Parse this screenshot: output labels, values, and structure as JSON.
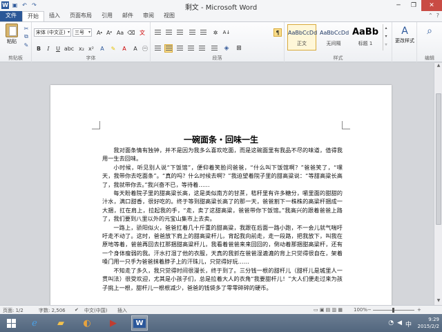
{
  "titlebar": {
    "title": "剩文 - Microsoft Word",
    "qat": [
      "word-icon",
      "save-icon",
      "undo-icon",
      "redo-icon"
    ]
  },
  "tabs": {
    "file": "文件",
    "items": [
      "开始",
      "插入",
      "页面布局",
      "引用",
      "邮件",
      "审阅",
      "视图"
    ],
    "active": "开始"
  },
  "ribbon": {
    "clipboard": {
      "paste": "粘贴",
      "label": "剪贴板"
    },
    "font": {
      "font_name": "宋体 (中文正)",
      "font_size": "三号",
      "label": "字体",
      "bold": "B",
      "italic": "I",
      "underline": "U"
    },
    "paragraph": {
      "label": "段落"
    },
    "styles": {
      "label": "样式",
      "items": [
        {
          "sample": "AaBbCcDd",
          "name": "正文"
        },
        {
          "sample": "AaBbCcDd",
          "name": "无间隔"
        },
        {
          "sample": "AaBb",
          "name": "标题 1"
        }
      ],
      "change_styles": "更改样式"
    },
    "editing": {
      "label": "编辑"
    }
  },
  "document": {
    "title": "一碗面条・回味一生",
    "paragraphs": [
      "我对面条情有独钟，并不是因为我多么喜欢吃面，而是这碗面里有我品不尽的味道，值得我用一生去回味。",
      "小时候，听见别人说“下饭馆”，便仰着笑脸问爸爸，“什么叫下饭馆啊？”爸爸笑了，“嘿天，我带你去吃面条”。“真的吗？什么时候去啊？”我迫望着院子里的甜高粱说：“等甜高粱长高了，我就带你去。”我兴奋不已，等待着……",
      "每天盼着院子里的甜高粱长高，这是类似南方的甘蔗，秸秆里有许多糖分，嚼里面的甜甜的汁水，满口甜香，很好吃的。终于等到甜高粱长高了的那一天，爸爸割下一株株的高粱杆捆成一大捆，扛在肩上，拉起我的手，“走，卖了这甜高粱，爸爸带你下饭馆。”我高兴的跟着爸爸上路了，我们要到八里以外的元宝山集市上去卖。",
      "一路上，骄阳似火，爸爸扛着几十斤重的甜高粱，我跟在后面一路小跑，不一会儿就气喘吁吁走不动了。这时，爸爸放下肩上的甜高粱杆儿，背起我向前走，走一段路，把我放下，叫我在原地等着，爸爸再回去扛那捆甜高粱杆儿，我看着爸爸来来回回的，倒动着那捆甜高粱杆，还有一个身体瘦弱的我。汗水打湿了他的衣服，天真的我抓在爸爸湿漉漉的背上只觉得很自在，架着嗓门用一只手为爸爸抹着脖子上的汗珠儿，只觉得好玩……",
      "不知走了多久，我只觉得时间很漫长，终于到了。三分钱一根的甜杆儿（甜杆儿是城里人一贯叫法）很受欢迎，尤其是小孩子们，总是拉着大人的衣角“我要甜杆儿！”大人们便走过来为孩子挑上一根，甜杆儿一根根减少，爸爸的钱袋多了零零碎碎的硬币。"
    ]
  },
  "statusbar": {
    "page": "页面: 1/2",
    "words": "字数: 2,506",
    "lang": "中文(中国)",
    "mode": "插入",
    "zoom": "100%"
  },
  "taskbar": {
    "apps": [
      "ie-icon",
      "folder-icon",
      "media-icon",
      "word-icon"
    ],
    "time": "9:29",
    "date": "2015/2/2",
    "ime": "中"
  }
}
